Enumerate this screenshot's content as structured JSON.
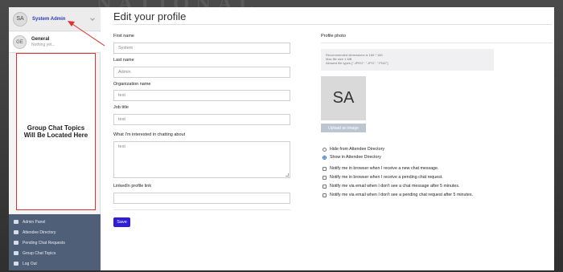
{
  "sidebar": {
    "user": {
      "initials": "SA",
      "name": "System Admin"
    },
    "topic": {
      "initials": "GE",
      "title": "General",
      "subtitle": "Nothing yet..."
    },
    "placeholder_text": "Group Chat Topics Will Be Located Here",
    "menu": [
      {
        "label": "Admin Panel",
        "icon": "dashboard-icon"
      },
      {
        "label": "Attendee Directory",
        "icon": "users-icon"
      },
      {
        "label": "Pending Chat Requests",
        "icon": "inbox-icon"
      },
      {
        "label": "Group Chat Topics",
        "icon": "chat-icon"
      },
      {
        "label": "Log Out",
        "icon": "logout-icon"
      }
    ]
  },
  "main": {
    "title": "Edit your profile",
    "fields": {
      "first_name": {
        "label": "First name",
        "value": "System"
      },
      "last_name": {
        "label": "Last name",
        "value": "Admin"
      },
      "organization": {
        "label": "Organization name",
        "value": "test"
      },
      "job_title": {
        "label": "Job title",
        "value": "test"
      },
      "interests": {
        "label": "What I'm interested in chatting about",
        "value": "test"
      },
      "linkedin": {
        "label": "LinkedIn profile link",
        "value": ""
      }
    },
    "save_label": "Save"
  },
  "photo": {
    "label": "Profile photo",
    "info": [
      "Recommended dimensions is 160 * 160",
      "Max file size 1 MB",
      "Allowed file types [\".JPEG\", \".JPG\", \".PNG\"]"
    ],
    "initials": "SA",
    "upload_label": "Upload an image"
  },
  "directory": {
    "hide_label": "Hide from Attendee Directory",
    "show_label": "Show in Attendee Directory",
    "selected": "show"
  },
  "notifications": [
    "Notify me in browser when I receive a new chat message.",
    "Notify me in browser when I receive a pending chat request.",
    "Notify me via email when I don't see a chat message after 5 minutes.",
    "Notify me via email when I don't see a pending chat request after 5 minutes."
  ],
  "colors": {
    "accent": "#2f1ed6",
    "annotation": "#e03030",
    "sidebar_menu": "#4f5f77",
    "user_name": "#2a3bbd"
  }
}
